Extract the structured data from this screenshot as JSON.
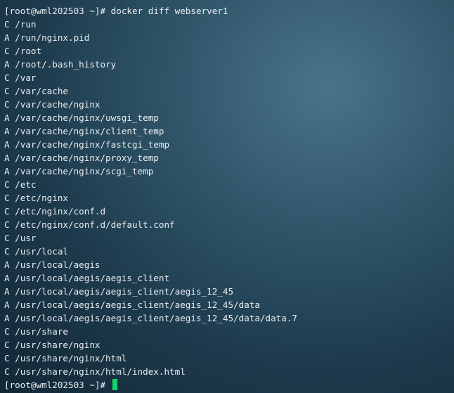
{
  "terminal": {
    "command_line": {
      "prompt": "[root@wml202503 ~]#",
      "command": "docker diff webserver1"
    },
    "output": [
      "C /run",
      "A /run/nginx.pid",
      "C /root",
      "A /root/.bash_history",
      "C /var",
      "C /var/cache",
      "C /var/cache/nginx",
      "A /var/cache/nginx/uwsgi_temp",
      "A /var/cache/nginx/client_temp",
      "A /var/cache/nginx/fastcgi_temp",
      "A /var/cache/nginx/proxy_temp",
      "A /var/cache/nginx/scgi_temp",
      "C /etc",
      "C /etc/nginx",
      "C /etc/nginx/conf.d",
      "C /etc/nginx/conf.d/default.conf",
      "C /usr",
      "C /usr/local",
      "A /usr/local/aegis",
      "A /usr/local/aegis/aegis_client",
      "A /usr/local/aegis/aegis_client/aegis_12_45",
      "A /usr/local/aegis/aegis_client/aegis_12_45/data",
      "A /usr/local/aegis/aegis_client/aegis_12_45/data/data.7",
      "C /usr/share",
      "C /usr/share/nginx",
      "C /usr/share/nginx/html",
      "C /usr/share/nginx/html/index.html"
    ],
    "final_prompt": "[root@wml202503 ~]#",
    "colors": {
      "text": "#e9eef1",
      "cursor": "#12d46b",
      "background": "#2f5468"
    }
  }
}
